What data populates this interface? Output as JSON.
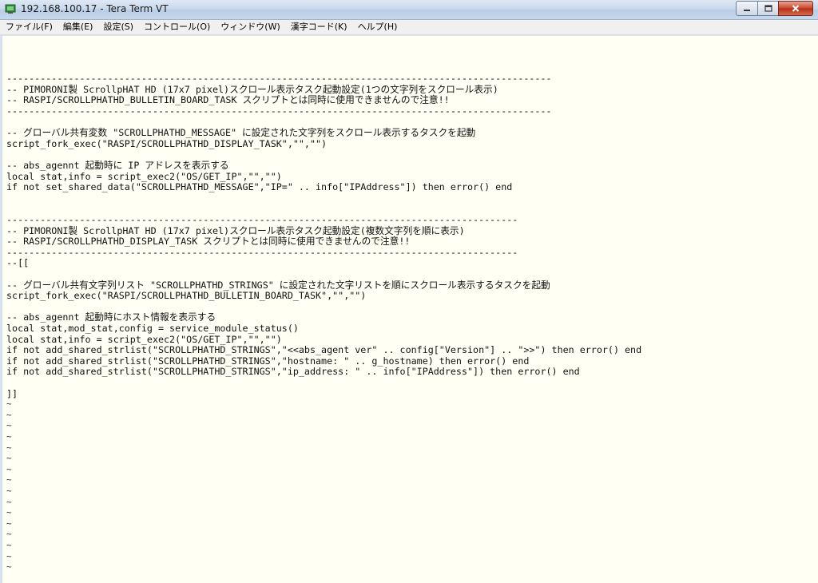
{
  "window": {
    "title": "192.168.100.17 - Tera Term VT"
  },
  "menu": [
    "ファイル(F)",
    "編集(E)",
    "設定(S)",
    "コントロール(O)",
    "ウィンドウ(W)",
    "漢字コード(K)",
    "ヘルプ(H)"
  ],
  "terminal": {
    "lines": [
      "",
      "",
      "-------------------------------------------------------------------------------------------------",
      "-- PIMORONI製 ScrollpHAT HD (17x7 pixel)スクロール表示タスク起動設定(1つの文字列をスクロール表示)",
      "-- RASPI/SCROLLPHATHD_BULLETIN_BOARD_TASK スクリプトとは同時に使用できませんので注意!!",
      "-------------------------------------------------------------------------------------------------",
      "",
      "-- グローバル共有変数 \"SCROLLPHATHD_MESSAGE\" に設定された文字列をスクロール表示するタスクを起動",
      "script_fork_exec(\"RASPI/SCROLLPHATHD_DISPLAY_TASK\",\"\",\"\")",
      "",
      "-- abs_agennt 起動時に IP アドレスを表示する",
      "local stat,info = script_exec2(\"OS/GET_IP\",\"\",\"\")",
      "if not set_shared_data(\"SCROLLPHATHD_MESSAGE\",\"IP=\" .. info[\"IPAddress\"]) then error() end",
      "",
      "",
      "-------------------------------------------------------------------------------------------",
      "-- PIMORONI製 ScrollpHAT HD (17x7 pixel)スクロール表示タスク起動設定(複数文字列を順に表示)",
      "-- RASPI/SCROLLPHATHD_DISPLAY_TASK スクリプトとは同時に使用できませんので注意!!",
      "-------------------------------------------------------------------------------------------",
      "--[[",
      "",
      "-- グローバル共有文字列リスト \"SCROLLPHATHD_STRINGS\" に設定された文字リストを順にスクロール表示するタスクを起動",
      "script_fork_exec(\"RASPI/SCROLLPHATHD_BULLETIN_BOARD_TASK\",\"\",\"\")",
      "",
      "-- abs_agennt 起動時にホスト情報を表示する",
      "local stat,mod_stat,config = service_module_status()",
      "local stat,info = script_exec2(\"OS/GET_IP\",\"\",\"\")",
      "if not add_shared_strlist(\"SCROLLPHATHD_STRINGS\",\"<<abs_agent ver\" .. config[\"Version\"] .. \">>\") then error() end",
      "if not add_shared_strlist(\"SCROLLPHATHD_STRINGS\",\"hostname: \" .. g_hostname) then error() end",
      "if not add_shared_strlist(\"SCROLLPHATHD_STRINGS\",\"ip_address: \" .. info[\"IPAddress\"]) then error() end",
      "",
      "]]",
      "~",
      "~",
      "~",
      "~",
      "~",
      "~",
      "~",
      "~",
      "~",
      "~",
      "~",
      "~",
      "~",
      "~",
      "~",
      "~"
    ]
  }
}
